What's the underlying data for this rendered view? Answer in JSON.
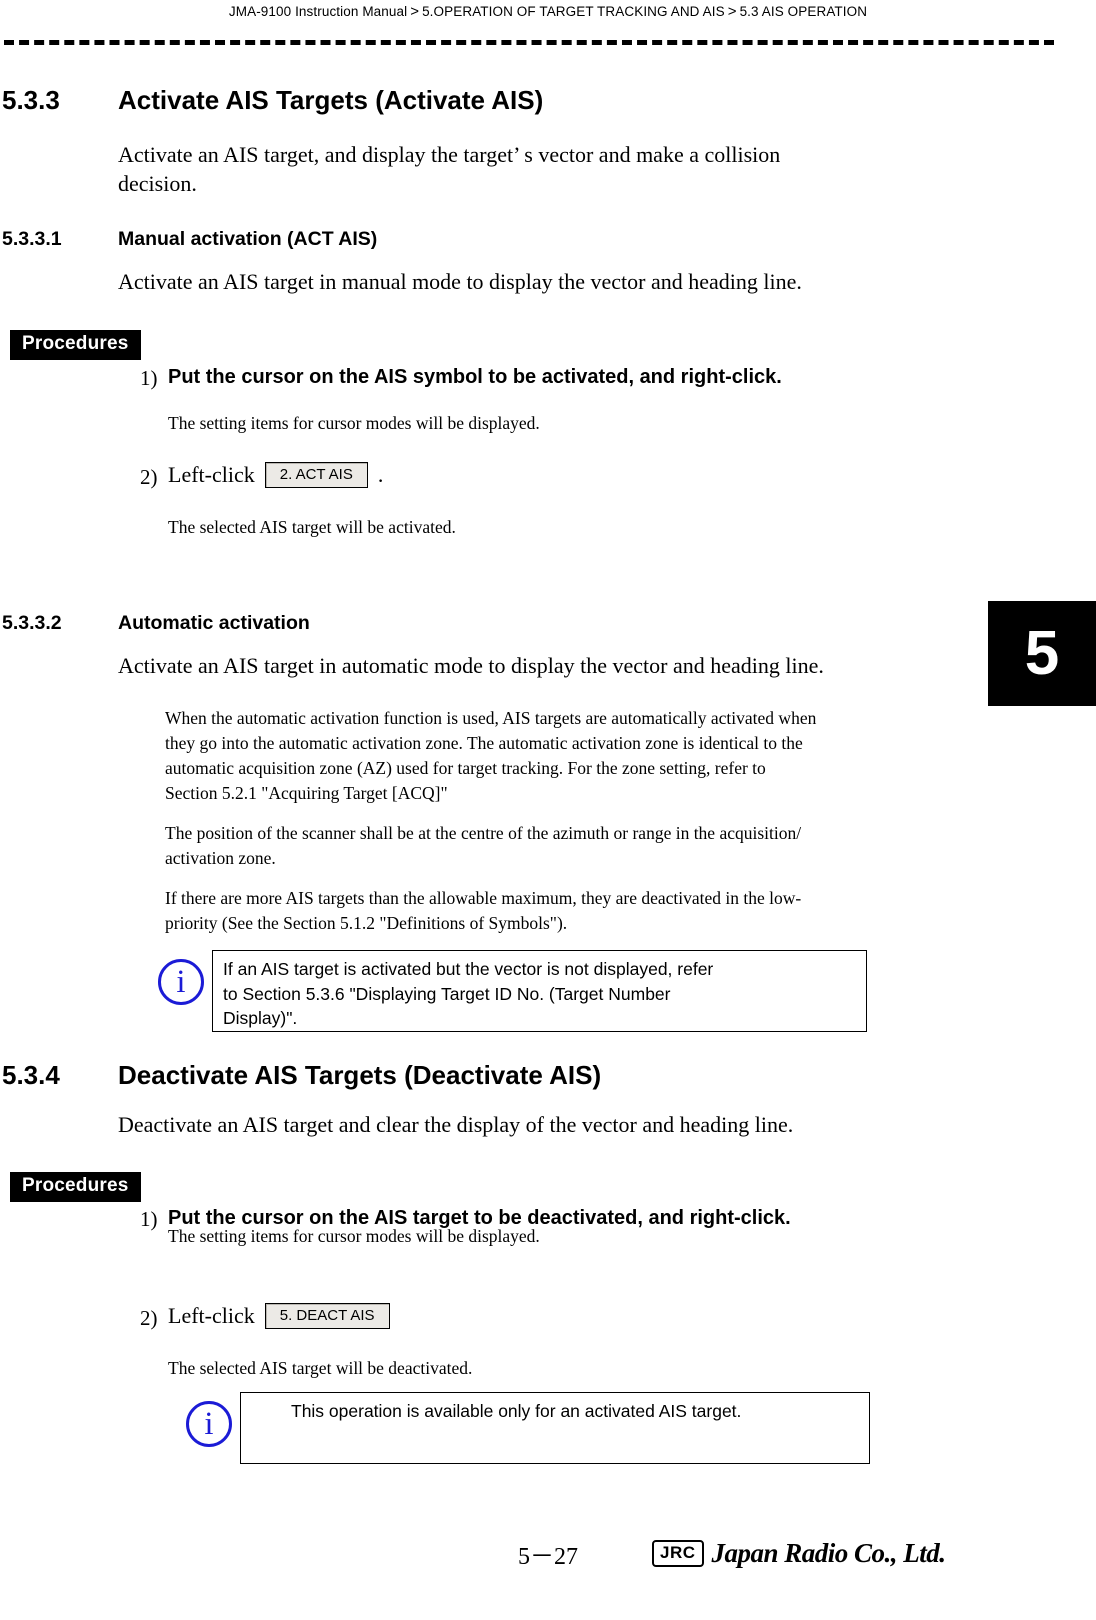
{
  "header": {
    "manual": "JMA-9100 Instruction Manual",
    "sep": "&gt;",
    "crumb1": "5.OPERATION OF TARGET TRACKING AND AIS",
    "crumb2": "5.3  AIS OPERATION"
  },
  "chapter_tab": "5",
  "sections": {
    "s533": {
      "number": "5.3.3",
      "title": "Activate AIS Targets (Activate AIS)",
      "intro_line1": "Activate an AIS target, and display the target’ s vector and make a collision",
      "intro_line2": "decision."
    },
    "s5331": {
      "number": "5.3.3.1",
      "title": "Manual activation (ACT AIS)",
      "intro": "Activate an AIS target in manual mode to display the vector and heading line.",
      "procedures_label": "Procedures",
      "step1_num": "1)",
      "step1_text": "Put the cursor on the AIS symbol to be activated, and right-click.",
      "step1_sub": "The setting items for cursor modes will be displayed.",
      "step2_num": "2)",
      "step2_prefix": "Left-click",
      "step2_chip": "2. ACT AIS",
      "step2_suffix": ".",
      "step2_sub": "The selected AIS target will be activated."
    },
    "s5332": {
      "number": "5.3.3.2",
      "title": "Automatic activation",
      "intro": "Activate an AIS target in automatic mode to display the vector and heading line.",
      "para1_l1": "When the automatic activation function is used, AIS targets are automatically activated when",
      "para1_l2": "they go into the automatic activation zone. The automatic activation zone is identical to the",
      "para1_l3": "automatic acquisition zone (AZ) used for target tracking. For the zone setting, refer to",
      "para1_l4": "Section 5.2.1 \"Acquiring Target [ACQ]\"",
      "para2_l1": "The position of the scanner shall be at the centre of the azimuth or range in the acquisition/",
      "para2_l2": "activation zone.",
      "para3_l1": "If there are more AIS targets than the allowable maximum, they are deactivated in the low-",
      "para3_l2": "priority (See the Section 5.1.2 \"Definitions of Symbols\").",
      "note_icon": "i",
      "note_l1": "If an AIS target is activated but the vector is not displayed, refer",
      "note_l2": "to Section 5.3.6 \"Displaying Target ID No. (Target Number",
      "note_l3": "Display)\"."
    },
    "s534": {
      "number": "5.3.4",
      "title": "Deactivate AIS Targets (Deactivate AIS)",
      "intro": "Deactivate an AIS target and clear the display of the vector and heading line.",
      "procedures_label": "Procedures",
      "step1_num": "1)",
      "step1_text": "Put the cursor on the AIS target to be deactivated, and right-click.",
      "step1_sub": "The setting items for cursor modes will be displayed.",
      "step2_num": "2)",
      "step2_prefix": "Left-click",
      "step2_chip": "5. DEACT AIS",
      "step2_sub": "The selected AIS target will be deactivated.",
      "note_icon": "i",
      "note_text": "This operation is available only for an activated AIS target."
    }
  },
  "footer": {
    "page": "5－27",
    "jrc_badge": "JRC",
    "jrc_wordmark": "Japan Radio Co., Ltd."
  }
}
